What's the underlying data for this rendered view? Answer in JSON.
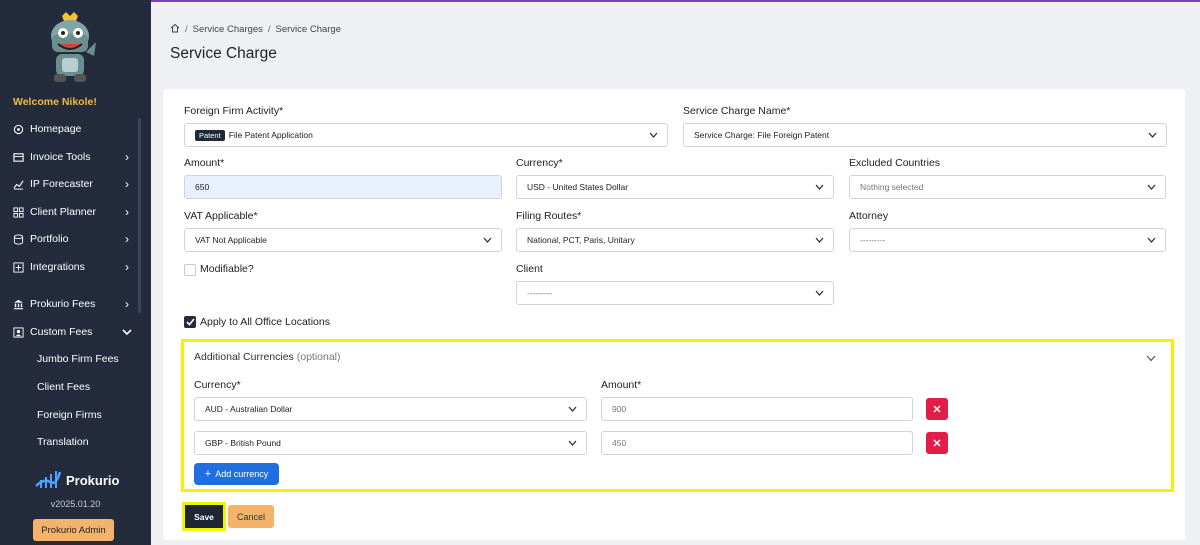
{
  "sidebar": {
    "welcome": "Welcome Nikole!",
    "items": [
      {
        "label": "Homepage",
        "icon": "home-icon",
        "chevron": false
      },
      {
        "label": "Invoice Tools",
        "icon": "invoice-icon",
        "chevron": true
      },
      {
        "label": "IP Forecaster",
        "icon": "chart-icon",
        "chevron": true
      },
      {
        "label": "Client Planner",
        "icon": "grid-icon",
        "chevron": true
      },
      {
        "label": "Portfolio",
        "icon": "database-icon",
        "chevron": true
      },
      {
        "label": "Integrations",
        "icon": "plus-square-icon",
        "chevron": true
      },
      {
        "label": "Prokurio Fees",
        "icon": "building-icon",
        "chevron": true
      },
      {
        "label": "Custom Fees",
        "icon": "person-square-icon",
        "chevron": true,
        "expanded": true
      }
    ],
    "sub_items": [
      "Jumbo Firm Fees",
      "Client Fees",
      "Foreign Firms",
      "Translation"
    ],
    "brand": "Prokurio",
    "version": "v2025.01.20",
    "admin_button": "Prokurio Admin"
  },
  "breadcrumb": {
    "items": [
      "Service Charges",
      "Service Charge"
    ]
  },
  "page_title": "Service Charge",
  "form": {
    "foreign_firm_activity": {
      "label": "Foreign Firm Activity*",
      "tag": "Patent",
      "value": "File Patent Application"
    },
    "service_charge_name": {
      "label": "Service Charge Name*",
      "value": "Service Charge: File Foreign Patent"
    },
    "amount": {
      "label": "Amount*",
      "value": "650"
    },
    "currency": {
      "label": "Currency*",
      "value": "USD - United States Dollar"
    },
    "excluded_countries": {
      "label": "Excluded Countries",
      "placeholder": "Nothing selected"
    },
    "vat_applicable": {
      "label": "VAT Applicable*",
      "value": "VAT Not Applicable"
    },
    "filing_routes": {
      "label": "Filing Routes*",
      "value": "National, PCT, Paris, Unitary"
    },
    "attorney": {
      "label": "Attorney",
      "value": "---------"
    },
    "modifiable": {
      "label": "Modifiable?"
    },
    "client": {
      "label": "Client",
      "value": "---------"
    },
    "apply_all": {
      "label": "Apply to All Office Locations"
    }
  },
  "additional_currencies": {
    "title": "Additional Currencies",
    "optional": "(optional)",
    "currency_header": "Currency*",
    "amount_header": "Amount*",
    "rows": [
      {
        "currency": "AUD - Australian Dollar",
        "amount": "900"
      },
      {
        "currency": "GBP - British Pound",
        "amount": "450"
      }
    ],
    "add_button": "Add currency",
    "add_button_plus": "+"
  },
  "actions": {
    "save": "Save",
    "cancel": "Cancel"
  },
  "colors": {
    "sidebar": "#232b3d",
    "accent": "#f4b942",
    "primary": "#1f6fe0",
    "danger": "#e11d48",
    "highlight": "#f4f200"
  }
}
